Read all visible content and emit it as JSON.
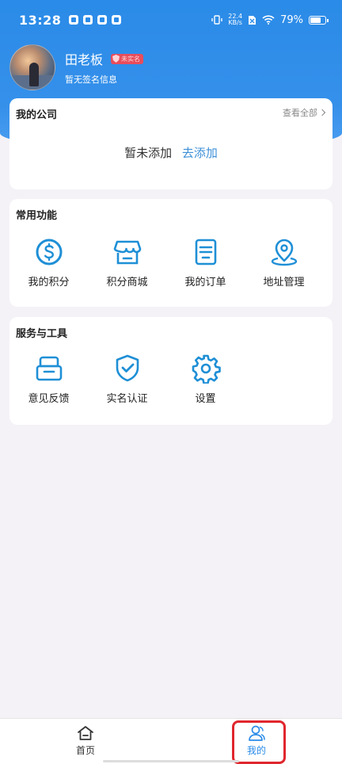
{
  "status_bar": {
    "time": "13:28",
    "net_speed_value": "22.4",
    "net_speed_unit": "KB/s",
    "battery_text": "79%",
    "battery_level": 0.79
  },
  "profile": {
    "name": "田老板",
    "badge": "未实名",
    "signature": "暂无签名信息"
  },
  "company": {
    "title": "我的公司",
    "view_all": "查看全部",
    "empty_text": "暂未添加",
    "add_link": "去添加"
  },
  "common_functions": {
    "title": "常用功能",
    "items": [
      {
        "label": "我的积分",
        "icon": "points-dollar-icon"
      },
      {
        "label": "积分商城",
        "icon": "store-icon"
      },
      {
        "label": "我的订单",
        "icon": "order-list-icon"
      },
      {
        "label": "地址管理",
        "icon": "location-pin-icon"
      }
    ]
  },
  "services": {
    "title": "服务与工具",
    "items": [
      {
        "label": "意见反馈",
        "icon": "feedback-icon"
      },
      {
        "label": "实名认证",
        "icon": "shield-check-icon"
      },
      {
        "label": "设置",
        "icon": "gear-icon"
      }
    ]
  },
  "tabbar": {
    "home_label": "首页",
    "mine_label": "我的",
    "active": "mine"
  },
  "colors": {
    "accent": "#2a8be8",
    "icon_blue": "#1e8fd6",
    "highlight_red": "#e0262d",
    "badge_red": "#e84d5b"
  }
}
